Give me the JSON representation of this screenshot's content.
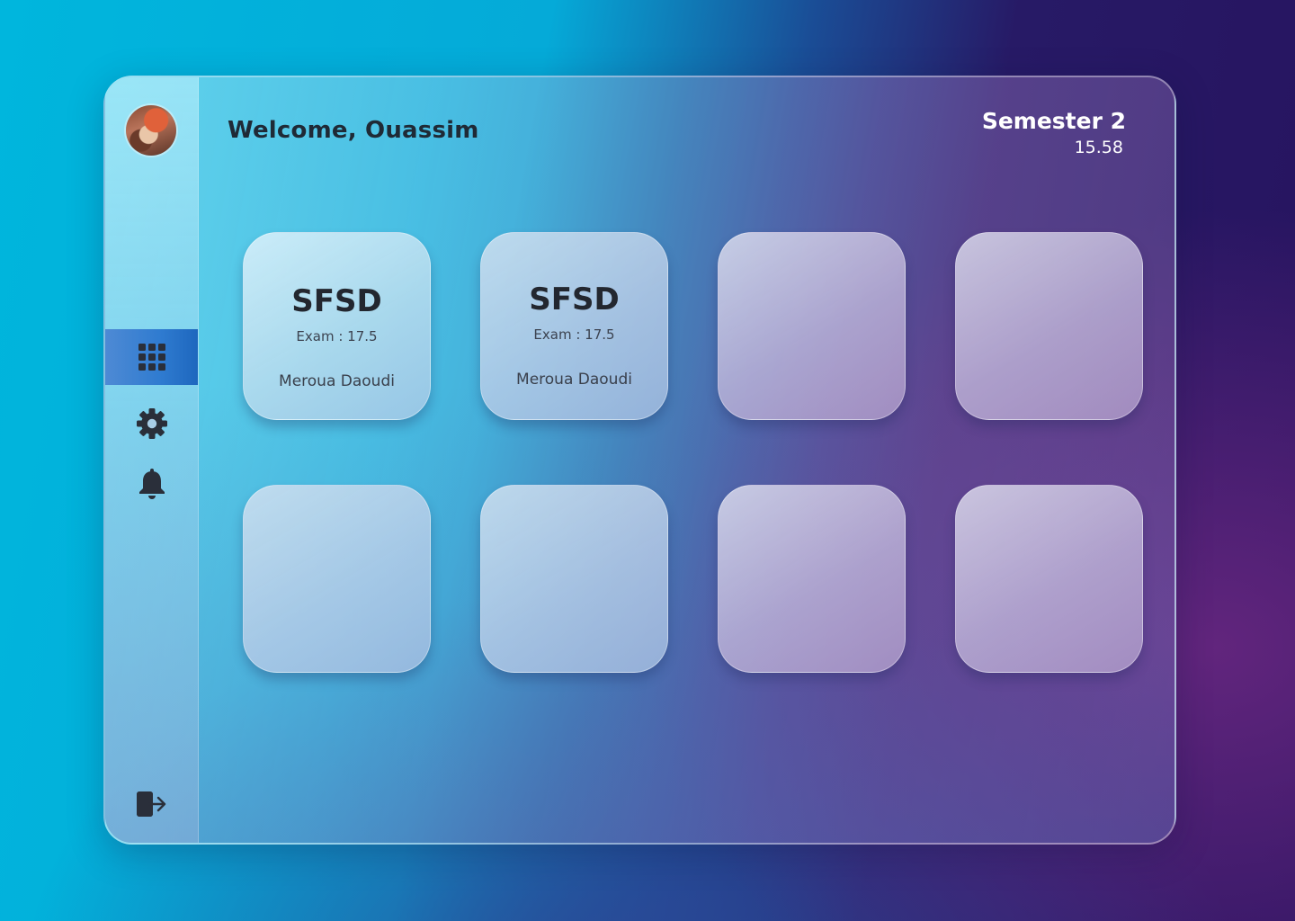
{
  "header": {
    "welcome": "Welcome, Ouassim",
    "semester_title": "Semester 2",
    "semester_average": "15.58"
  },
  "sidebar": {
    "avatar": "user-avatar",
    "items": [
      {
        "name": "dashboard",
        "icon": "grid-icon",
        "active": true
      },
      {
        "name": "settings",
        "icon": "gear-icon",
        "active": false
      },
      {
        "name": "notifications",
        "icon": "bell-icon",
        "active": false
      }
    ],
    "logout_icon": "logout-icon"
  },
  "cards": [
    {
      "title": "SFSD",
      "exam": "Exam : 17.5",
      "teacher": "Meroua Daoudi"
    },
    {
      "title": "SFSD",
      "exam": "Exam : 17.5",
      "teacher": "Meroua Daoudi"
    },
    {},
    {},
    {},
    {},
    {},
    {}
  ],
  "colors": {
    "accent": "#2f7bd0",
    "text_dark": "#1f2a36",
    "text_light": "#ffffff"
  }
}
